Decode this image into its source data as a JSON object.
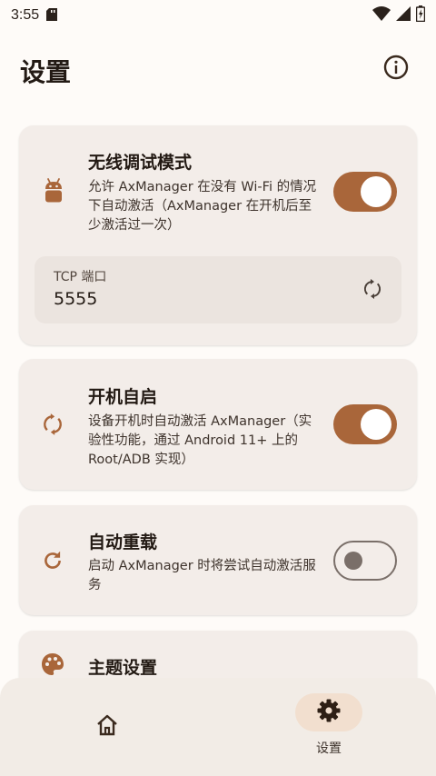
{
  "status_bar": {
    "time": "3:55"
  },
  "header": {
    "title": "设置"
  },
  "cards": {
    "wireless_debug": {
      "title": "无线调试模式",
      "description": "允许 AxManager 在没有 Wi-Fi 的情况下自动激活（AxManager 在开机后至少激活过一次）",
      "enabled": true,
      "tcp": {
        "label": "TCP 端口",
        "value": "5555"
      }
    },
    "boot_start": {
      "title": "开机自启",
      "description": "设备开机时自动激活 AxManager（实验性功能，通过 Android 11+ 上的 Root/ADB 实现）",
      "enabled": true
    },
    "auto_reload": {
      "title": "自动重载",
      "description": "启动 AxManager 时将尝试自动激活服务",
      "enabled": false
    },
    "theme": {
      "title": "主题设置"
    }
  },
  "bottom_nav": {
    "settings_label": "设置"
  },
  "colors": {
    "accent": "#a9663a",
    "icon": "#a9663a",
    "card_bg": "#f3ede9",
    "page_bg": "#fefbf8"
  }
}
